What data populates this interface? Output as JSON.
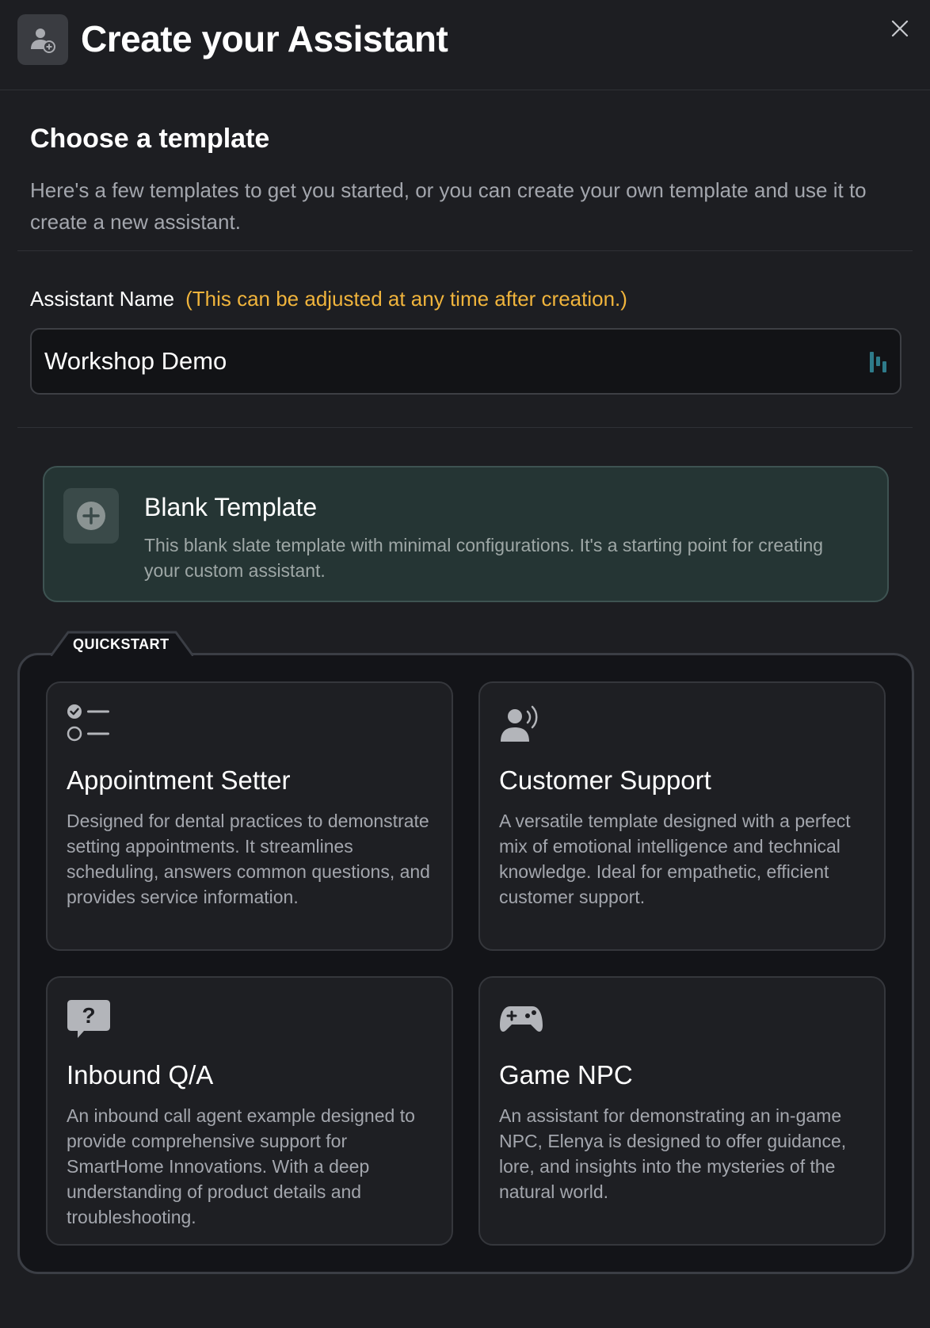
{
  "header": {
    "title": "Create your Assistant",
    "icon": "user-plus-icon",
    "close_icon": "close-icon"
  },
  "template_section": {
    "title": "Choose a template",
    "description": "Here's a few templates to get you started, or you can create your own template and use it to create a new assistant."
  },
  "assistant_name": {
    "label": "Assistant Name",
    "hint": "(This can be adjusted at any time after creation.)",
    "value": "Workshop Demo"
  },
  "blank_template": {
    "title": "Blank Template",
    "description": "This blank slate template with minimal configurations. It's a starting point for creating your custom assistant.",
    "icon": "plus-circle-icon"
  },
  "quickstart": {
    "label": "QUICKSTART",
    "templates": [
      {
        "title": "Appointment Setter",
        "description": "Designed for dental practices to demonstrate setting appointments. It streamlines scheduling, answers common questions, and provides service information.",
        "icon": "checklist-icon"
      },
      {
        "title": "Customer Support",
        "description": "A versatile template designed with a perfect mix of emotional intelligence and technical knowledge. Ideal for empathetic, efficient customer support.",
        "icon": "person-speaking-icon"
      },
      {
        "title": "Inbound Q/A",
        "description": "An inbound call agent example designed to provide comprehensive support for SmartHome Innovations. With a deep understanding of product details and troubleshooting.",
        "icon": "question-bubble-icon"
      },
      {
        "title": "Game NPC",
        "description": "An assistant for demonstrating an in-game NPC, Elenya is designed to offer guidance, lore, and insights into the mysteries of the natural world.",
        "icon": "gamepad-icon"
      }
    ]
  },
  "colors": {
    "background": "#1d1e22",
    "hint_accent": "#f0b43c",
    "blank_card_bg": "#253534",
    "quickstart_bg": "#131418"
  }
}
